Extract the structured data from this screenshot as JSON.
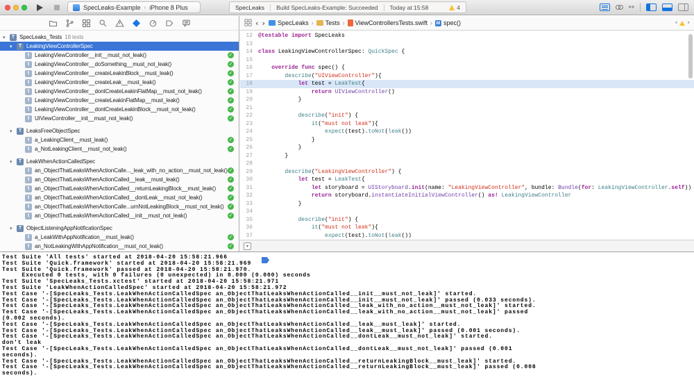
{
  "toolbar": {
    "scheme": {
      "name": "SpecLeaks-Example",
      "destination": "iPhone 8 Plus"
    },
    "activity": {
      "project": "SpecLeaks",
      "status": "Build SpecLeaks-Example: Succeeded",
      "time": "Today at 15:58",
      "warning_count": "4"
    }
  },
  "icons": {
    "back_chevron": "‹",
    "forward_chevron": "›",
    "breadcrumb_separator": "›",
    "scheme_separator": "›",
    "disclosure_triangle": "▾",
    "check_mark": "✓",
    "class_letter": "T",
    "method_letter": "t",
    "jump_method_letter": "M",
    "version_editor_arrows": "↔",
    "debug_toggle_chevron": "▾",
    "prev_issue_chevron": "‹",
    "next_issue_chevron": "›"
  },
  "navigator": {
    "items": [
      {
        "label": "SpecLeaks_Tests",
        "count": "18 tests",
        "level": 0,
        "kind": "target",
        "expandable": true
      },
      {
        "label": "LeakingViewControllerSpec",
        "level": 1,
        "kind": "spec",
        "expandable": true,
        "selected": true
      },
      {
        "label": "LeakingViewController__init__must_not_leak()",
        "level": 2,
        "kind": "test",
        "passed": true
      },
      {
        "label": "LeakingViewController__doSomething__must_not_leak()",
        "level": 2,
        "kind": "test",
        "passed": true
      },
      {
        "label": "LeakingViewController__createLeakinBlock__must_leak()",
        "level": 2,
        "kind": "test",
        "passed": true
      },
      {
        "label": "LeakingViewController__createLeak__must_leak()",
        "level": 2,
        "kind": "test",
        "passed": true
      },
      {
        "label": "LeakingViewController__dontCreateLeakinFlatMap__must_not_leak()",
        "level": 2,
        "kind": "test",
        "passed": true
      },
      {
        "label": "LeakingViewController__createLeakinFlatMap__must_leak()",
        "level": 2,
        "kind": "test",
        "passed": true
      },
      {
        "label": "LeakingViewController__dontCreateLeakinBlock__must_not_leak()",
        "level": 2,
        "kind": "test",
        "passed": true
      },
      {
        "label": "UIViewController__init__must_not_leak()",
        "level": 2,
        "kind": "test",
        "passed": true
      },
      {
        "label": "LeaksFreeObjectSpec",
        "level": 1,
        "kind": "spec",
        "expandable": true,
        "gap": true
      },
      {
        "label": "a_LeakingClient__must_leak()",
        "level": 2,
        "kind": "test",
        "passed": true
      },
      {
        "label": "a_NotLeakingClient__must_not_leak()",
        "level": 2,
        "kind": "test",
        "passed": true
      },
      {
        "label": "LeakWhenActionCalledSpec",
        "level": 1,
        "kind": "spec",
        "expandable": true,
        "gap": true
      },
      {
        "label": "an_ObjectThatLeaksWhenActionCalle..._leak_with_no_action__must_not_leak()",
        "level": 2,
        "kind": "test",
        "passed": true
      },
      {
        "label": "an_ObjectThatLeaksWhenActionCalled__leak__must_leak()",
        "level": 2,
        "kind": "test",
        "passed": true
      },
      {
        "label": "an_ObjectThatLeaksWhenActionCalled__returnLeakingBlock__must_leak()",
        "level": 2,
        "kind": "test",
        "passed": true
      },
      {
        "label": "an_ObjectThatLeaksWhenActionCalled__dontLeak__must_not_leak()",
        "level": 2,
        "kind": "test",
        "passed": true
      },
      {
        "label": "an_ObjectThatLeaksWhenActionCalle...urnNotLeakingBlock__must_not_leak()",
        "level": 2,
        "kind": "test",
        "passed": true
      },
      {
        "label": "an_ObjectThatLeaksWhenActionCalled__init__must_not_leak()",
        "level": 2,
        "kind": "test",
        "passed": true
      },
      {
        "label": "ObjectListeningAppNotificationSpec",
        "level": 1,
        "kind": "spec",
        "expandable": true,
        "gap": true
      },
      {
        "label": "a_LeakWithAppNotification__must_leak()",
        "level": 2,
        "kind": "test",
        "passed": true
      },
      {
        "label": "an_NotLeakingWithAppNotification__must_not_leak()",
        "level": 2,
        "kind": "test",
        "passed": true
      }
    ]
  },
  "jumpbar": {
    "crumbs": [
      {
        "label": "SpecLeaks",
        "icon": "folder-blue"
      },
      {
        "label": "Tests",
        "icon": "folder-yellow"
      },
      {
        "label": "ViewControllersTests.swift",
        "icon": "swift-file"
      },
      {
        "label": "spec()",
        "icon": "method"
      }
    ]
  },
  "editor": {
    "file": "ViewControllersTests.swift",
    "highlight_line": 18,
    "lines": [
      {
        "n": 12,
        "seg": [
          [
            "k",
            "@testable"
          ],
          [
            "n",
            " "
          ],
          [
            "k",
            "import"
          ],
          [
            "n",
            " SpecLeaks"
          ]
        ]
      },
      {
        "n": 13,
        "seg": []
      },
      {
        "n": 14,
        "seg": [
          [
            "k",
            "class"
          ],
          [
            "n",
            " LeakingViewControllerSpec: "
          ],
          [
            "t",
            "QuickSpec"
          ],
          [
            "n",
            " {"
          ]
        ]
      },
      {
        "n": 15,
        "seg": []
      },
      {
        "n": 16,
        "seg": [
          [
            "n",
            "    "
          ],
          [
            "k",
            "override"
          ],
          [
            "n",
            " "
          ],
          [
            "k",
            "func"
          ],
          [
            "n",
            " spec() {"
          ]
        ]
      },
      {
        "n": 17,
        "seg": [
          [
            "n",
            "        "
          ],
          [
            "t",
            "describe"
          ],
          [
            "n",
            "("
          ],
          [
            "s",
            "\"UIViewController\""
          ],
          [
            "n",
            "){"
          ]
        ]
      },
      {
        "n": 18,
        "seg": [
          [
            "n",
            "            "
          ],
          [
            "k",
            "let"
          ],
          [
            "n",
            " test = "
          ],
          [
            "t",
            "LeakTest"
          ],
          [
            "n",
            "{"
          ]
        ]
      },
      {
        "n": 19,
        "seg": [
          [
            "n",
            "                "
          ],
          [
            "k",
            "return"
          ],
          [
            "n",
            " "
          ],
          [
            "u",
            "UIViewController"
          ],
          [
            "n",
            "()"
          ]
        ]
      },
      {
        "n": 20,
        "seg": [
          [
            "n",
            "            }"
          ]
        ]
      },
      {
        "n": 21,
        "seg": []
      },
      {
        "n": 22,
        "seg": [
          [
            "n",
            "            "
          ],
          [
            "t",
            "describe"
          ],
          [
            "n",
            "("
          ],
          [
            "s",
            "\"init\""
          ],
          [
            "n",
            ") {"
          ]
        ]
      },
      {
        "n": 23,
        "seg": [
          [
            "n",
            "                "
          ],
          [
            "t",
            "it"
          ],
          [
            "n",
            "("
          ],
          [
            "s",
            "\"must not leak\""
          ],
          [
            "n",
            "){"
          ]
        ]
      },
      {
        "n": 24,
        "seg": [
          [
            "n",
            "                    "
          ],
          [
            "t",
            "expect"
          ],
          [
            "n",
            "(test)."
          ],
          [
            "t",
            "toNot"
          ],
          [
            "n",
            "("
          ],
          [
            "t",
            "leak"
          ],
          [
            "n",
            "())"
          ]
        ]
      },
      {
        "n": 25,
        "seg": [
          [
            "n",
            "                }"
          ]
        ]
      },
      {
        "n": 26,
        "seg": [
          [
            "n",
            "            }"
          ]
        ]
      },
      {
        "n": 27,
        "seg": [
          [
            "n",
            "        }"
          ]
        ]
      },
      {
        "n": 28,
        "seg": []
      },
      {
        "n": 29,
        "seg": [
          [
            "n",
            "        "
          ],
          [
            "t",
            "describe"
          ],
          [
            "n",
            "("
          ],
          [
            "s",
            "\"LeakingViewController\""
          ],
          [
            "n",
            ") {"
          ]
        ]
      },
      {
        "n": 30,
        "seg": [
          [
            "n",
            "            "
          ],
          [
            "k",
            "let"
          ],
          [
            "n",
            " test = "
          ],
          [
            "t",
            "LeakTest"
          ],
          [
            "n",
            "{"
          ]
        ]
      },
      {
        "n": 31,
        "seg": [
          [
            "n",
            "                "
          ],
          [
            "k",
            "let"
          ],
          [
            "n",
            " storyboard = "
          ],
          [
            "u",
            "UIStoryboard"
          ],
          [
            "n",
            "."
          ],
          [
            "k",
            "init"
          ],
          [
            "n",
            "(name: "
          ],
          [
            "s",
            "\"LeakingViewController\""
          ],
          [
            "n",
            ", bundle: "
          ],
          [
            "u",
            "Bundle"
          ],
          [
            "n",
            "("
          ],
          [
            "k",
            "for"
          ],
          [
            "n",
            ": "
          ],
          [
            "t",
            "LeakingViewController"
          ],
          [
            "n",
            "."
          ],
          [
            "k",
            "self"
          ],
          [
            "n",
            "))"
          ]
        ]
      },
      {
        "n": 32,
        "seg": [
          [
            "n",
            "                "
          ],
          [
            "k",
            "return"
          ],
          [
            "n",
            " storyboard."
          ],
          [
            "u",
            "instantiateInitialViewController"
          ],
          [
            "n",
            "() "
          ],
          [
            "k",
            "as!"
          ],
          [
            "n",
            " "
          ],
          [
            "t",
            "LeakingViewController"
          ]
        ]
      },
      {
        "n": 33,
        "seg": [
          [
            "n",
            "            }"
          ]
        ]
      },
      {
        "n": 34,
        "seg": []
      },
      {
        "n": 35,
        "seg": [
          [
            "n",
            "            "
          ],
          [
            "t",
            "describe"
          ],
          [
            "n",
            "("
          ],
          [
            "s",
            "\"init\""
          ],
          [
            "n",
            ") {"
          ]
        ]
      },
      {
        "n": 36,
        "seg": [
          [
            "n",
            "                "
          ],
          [
            "t",
            "it"
          ],
          [
            "n",
            "("
          ],
          [
            "s",
            "\"must not leak\""
          ],
          [
            "n",
            "){"
          ]
        ]
      },
      {
        "n": 37,
        "seg": [
          [
            "n",
            "                    "
          ],
          [
            "t",
            "expect"
          ],
          [
            "n",
            "(test)."
          ],
          [
            "t",
            "toNot"
          ],
          [
            "n",
            "("
          ],
          [
            "t",
            "leak"
          ],
          [
            "n",
            "())"
          ]
        ]
      }
    ]
  },
  "console": {
    "rows": [
      "Test Suite 'All tests' started at 2018-04-20 15:58:21.966",
      "Test Suite 'Quick.framework' started at 2018-04-20 15:58:21.969",
      "Test Suite 'Quick.framework' passed at 2018-04-20 15:58:21.970.",
      "     Executed 0 tests, with 0 failures (0 unexpected) in 0.000 (0.000) seconds",
      "Test Suite 'SpecLeaks_Tests.xctest' started at 2018-04-20 15:58:21.971",
      "Test Suite 'LeakWhenActionCalledSpec' started at 2018-04-20 15:58:21.972",
      "Test Case '-[SpecLeaks_Tests.LeakWhenActionCalledSpec an_ObjectThatLeaksWhenActionCalled__init__must_not_leak]' started.",
      "Test Case '-[SpecLeaks_Tests.LeakWhenActionCalledSpec an_ObjectThatLeaksWhenActionCalled__init__must_not_leak]' passed (0.033 seconds).",
      "Test Case '-[SpecLeaks_Tests.LeakWhenActionCalledSpec an_ObjectThatLeaksWhenActionCalled__leak_with_no_action__must_not_leak]' started.",
      "Test Case '-[SpecLeaks_Tests.LeakWhenActionCalledSpec an_ObjectThatLeaksWhenActionCalled__leak_with_no_action__must_not_leak]' passed",
      "(0.002 seconds).",
      "Test Case '-[SpecLeaks_Tests.LeakWhenActionCalledSpec an_ObjectThatLeaksWhenActionCalled__leak__must_leak]' started.",
      "Test Case '-[SpecLeaks_Tests.LeakWhenActionCalledSpec an_ObjectThatLeaksWhenActionCalled__leak__must_leak]' passed (0.001 seconds).",
      "Test Case '-[SpecLeaks_Tests.LeakWhenActionCalledSpec an_ObjectThatLeaksWhenActionCalled__dontLeak__must_not_leak]' started.",
      "don't leak",
      "Test Case '-[SpecLeaks_Tests.LeakWhenActionCalledSpec an_ObjectThatLeaksWhenActionCalled__dontLeak__must_not_leak]' passed (0.001",
      "seconds).",
      "Test Case '-[SpecLeaks_Tests.LeakWhenActionCalledSpec an_ObjectThatLeaksWhenActionCalled__returnLeakingBlock__must_leak]' started.",
      "Test Case '-[SpecLeaks_Tests.LeakWhenActionCalledSpec an_ObjectThatLeaksWhenActionCalled__returnLeakingBlock__must_leak]' passed (0.008",
      "seconds)."
    ]
  },
  "colors": {
    "selection_blue": "#3B76D7",
    "pass_green": "#46B749",
    "warning_yellow": "#F7C331",
    "accent_blue": "#1673DE",
    "keyword_pink": "#9B2393",
    "string_red": "#D12F1B",
    "type_teal": "#3E8087",
    "system_purple": "#703DAA",
    "line_highlight": "#D9E6F8"
  }
}
